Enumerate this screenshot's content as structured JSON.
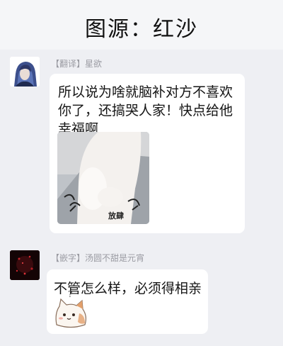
{
  "header": {
    "title": "图源：红沙"
  },
  "messages": [
    {
      "sender": "【翻译】星欲",
      "text": "所以说为啥就脑补对方不喜欢你了，还搞哭人家！快点给他幸福啊",
      "image_caption": "放肆"
    },
    {
      "sender": "【嵌字】汤圆不甜是元宵",
      "text": "不管怎么样，必须得相亲",
      "sticker_mark": "?"
    }
  ],
  "colors": {
    "background": "#eeeff3",
    "bubble": "#ffffff",
    "sender_text": "#9a9ba2",
    "message_text": "#141414"
  }
}
